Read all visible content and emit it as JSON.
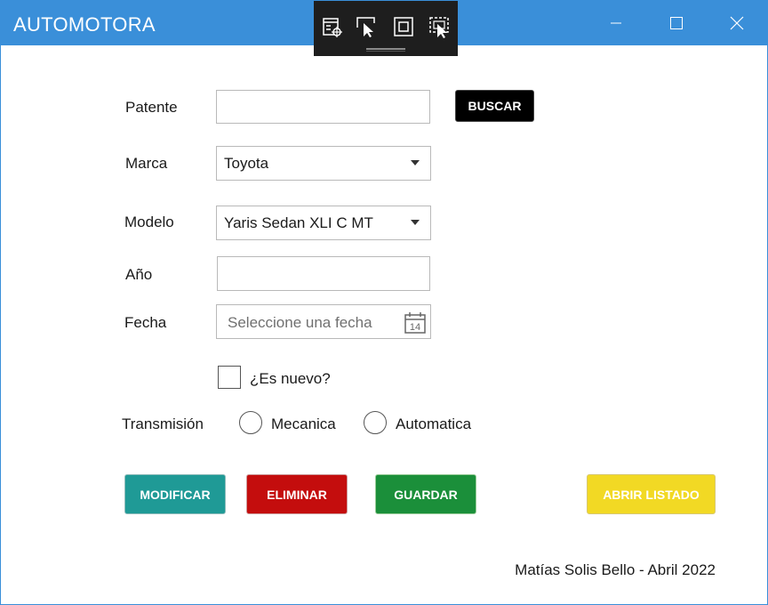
{
  "window": {
    "title": "AUTOMOTORA"
  },
  "form": {
    "patente_label": "Patente",
    "patente_value": "",
    "buscar_label": "BUSCAR",
    "marca_label": "Marca",
    "marca_value": "Toyota",
    "modelo_label": "Modelo",
    "modelo_value": "Yaris Sedan XLI C MT",
    "anio_label": "Año",
    "anio_value": "",
    "fecha_label": "Fecha",
    "fecha_placeholder": "Seleccione una fecha",
    "calendar_day": "14",
    "es_nuevo_label": "¿Es nuevo?",
    "transmision_label": "Transmisión",
    "mecanica_label": "Mecanica",
    "automatica_label": "Automatica"
  },
  "actions": {
    "modificar": "MODIFICAR",
    "eliminar": "ELIMINAR",
    "guardar": "GUARDAR",
    "abrir_listado": "ABRIR LISTADO"
  },
  "colors": {
    "titlebar": "#3a8fd9",
    "buscar": "#000000",
    "modificar": "#1f9a96",
    "eliminar": "#c40d0d",
    "guardar": "#1b8f3a",
    "abrir_listado": "#f2d924"
  },
  "footer": {
    "credit": "Matías Solis Bello - Abril 2022"
  }
}
